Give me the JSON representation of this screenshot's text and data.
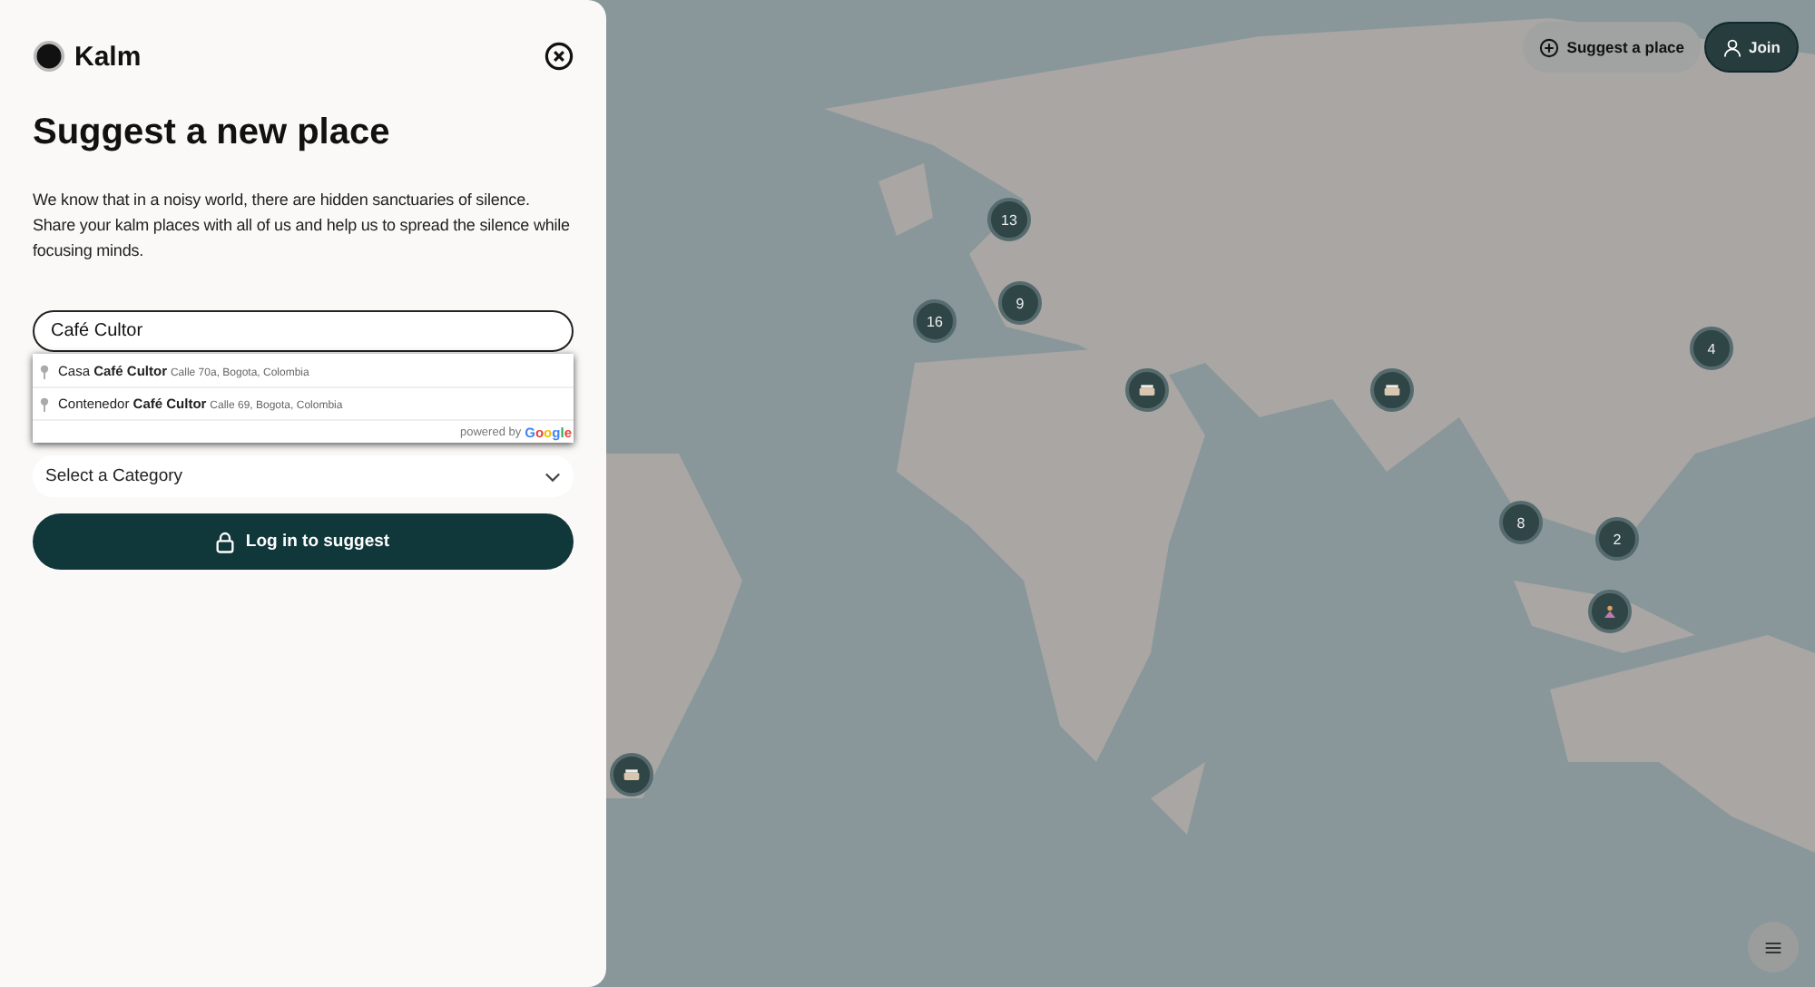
{
  "brand": {
    "name": "Kalm"
  },
  "panel": {
    "title": "Suggest a new place",
    "description": "We know that in a noisy world, there are hidden sanctuaries of silence. Share your kalm places with all of us and help us to spread the silence while focusing minds.",
    "search": {
      "value": "Café Cultor"
    },
    "suggestions": [
      {
        "name": "Casa **Café Cultor**",
        "address": "Calle 70a, Bogota, Colombia"
      },
      {
        "name": "Contenedor **Café Cultor**",
        "address": "Calle 69, Bogota, Colombia"
      }
    ],
    "powered_by": "powered by",
    "provider": "Google",
    "category": {
      "placeholder": "Select a Category"
    },
    "submit": "Log in to suggest"
  },
  "header_buttons": {
    "suggest": "Suggest a place",
    "join": "Join"
  },
  "map": {
    "markers": [
      {
        "kind": "cluster",
        "count": "13"
      },
      {
        "kind": "cluster",
        "count": "9"
      },
      {
        "kind": "cluster",
        "count": "16"
      },
      {
        "kind": "cafe"
      },
      {
        "kind": "cafe"
      },
      {
        "kind": "cluster",
        "count": "4"
      },
      {
        "kind": "cluster",
        "count": "8"
      },
      {
        "kind": "cluster",
        "count": "2"
      },
      {
        "kind": "meditation"
      },
      {
        "kind": "cafe"
      }
    ]
  }
}
